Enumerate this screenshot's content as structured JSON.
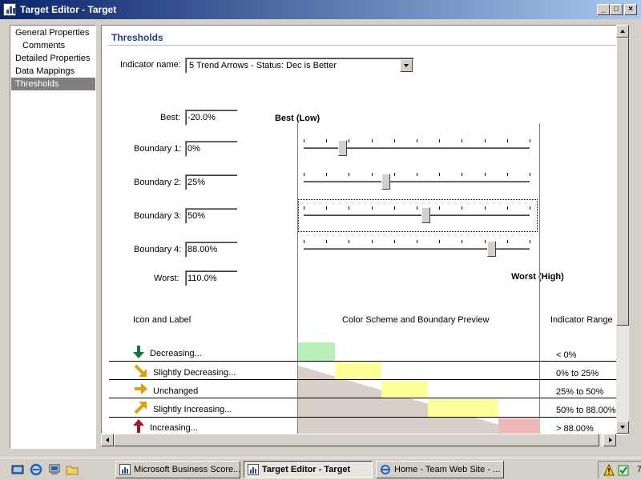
{
  "window": {
    "title": "Target Editor - Target"
  },
  "sidebar": {
    "items": [
      {
        "label": "General Properties"
      },
      {
        "label": "Comments"
      },
      {
        "label": "Detailed Properties"
      },
      {
        "label": "Data Mappings"
      },
      {
        "label": "Thresholds"
      }
    ],
    "selected": "Thresholds"
  },
  "thresholds": {
    "section_title": "Thresholds",
    "indicator_label": "Indicator name:",
    "indicator_value": "5 Trend Arrows - Status: Dec is Better",
    "best_label": "Best:",
    "best_value": "-20.0%",
    "boundaries": [
      {
        "label": "Boundary 1:",
        "value": "0%",
        "slider_fraction": 0.17
      },
      {
        "label": "Boundary 2:",
        "value": "25%",
        "slider_fraction": 0.36
      },
      {
        "label": "Boundary 3:",
        "value": "50%",
        "slider_fraction": 0.54
      },
      {
        "label": "Boundary 4:",
        "value": "88.00%",
        "slider_fraction": 0.83
      }
    ],
    "worst_label": "Worst:",
    "worst_value": "110.0%",
    "best_header": "Best (Low)",
    "worst_header": "Worst (High)",
    "col_icon_label": "Icon and Label",
    "col_preview": "Color Scheme and Boundary Preview",
    "col_range": "Indicator Range",
    "rows": [
      {
        "icon": "arrow-down-green-icon",
        "label": "Decreasing...",
        "range": "< 0%",
        "color": "#b8f0b8"
      },
      {
        "icon": "arrow-down-right-gold-icon",
        "label": "Slightly Decreasing...",
        "range": "0% to 25%",
        "color": "#ffff99"
      },
      {
        "icon": "arrow-right-gold-icon",
        "label": "Unchanged",
        "range": "25% to 50%",
        "color": "#ffff99"
      },
      {
        "icon": "arrow-up-right-gold-icon",
        "label": "Slightly Increasing...",
        "range": "50% to 88.00%",
        "color": "#ffff99"
      },
      {
        "icon": "arrow-up-red-icon",
        "label": "Increasing...",
        "range": "> 88.00%",
        "color": "#f0b8b8"
      }
    ]
  },
  "taskbar": {
    "items": [
      {
        "label": "Microsoft Business Score...",
        "active": false
      },
      {
        "label": "Target Editor - Target",
        "active": true
      },
      {
        "label": "Home - Team Web Site - ...",
        "active": false
      }
    ],
    "clock": "7"
  },
  "colors": {
    "title_start": "#0a246a",
    "title_end": "#a6caf0",
    "section_title": "#1f3f8f",
    "sidebar_selected": "#808080"
  }
}
